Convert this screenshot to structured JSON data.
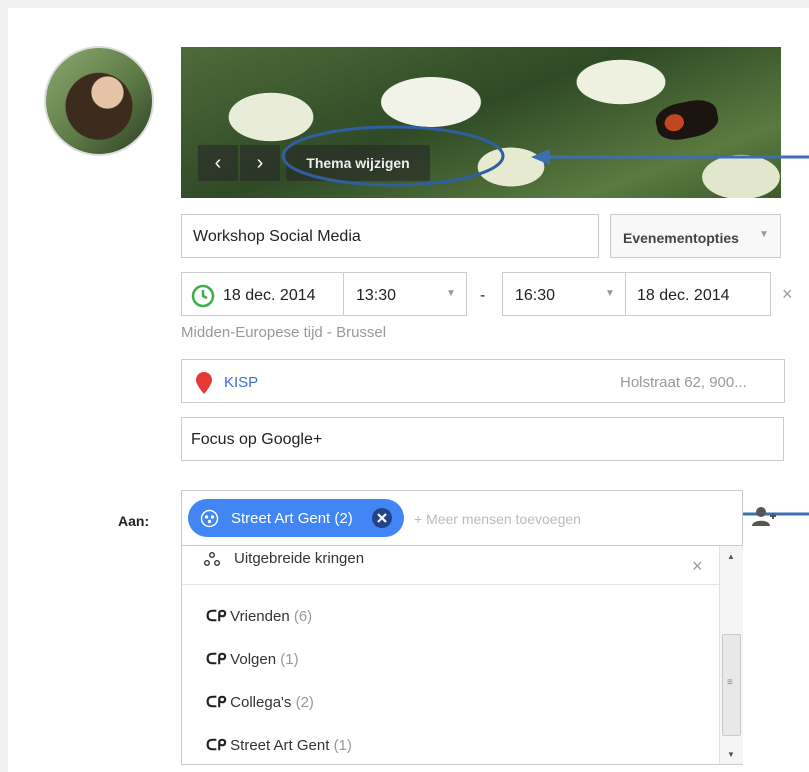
{
  "event": {
    "theme_button": "Thema wijzigen",
    "title_value": "Workshop Social Media",
    "options_label": "Evenementopties",
    "start_date": "18 dec. 2014",
    "start_time": "13:30",
    "separator": "-",
    "end_time": "16:30",
    "end_date": "18 dec. 2014",
    "timezone": "Midden-Europese tijd - Brussel",
    "location_name": "KISP",
    "location_address": "Holstraat 62, 900...",
    "description": "Focus op Google+"
  },
  "recipients": {
    "label": "Aan:",
    "chip_label": "Street Art Gent (2)",
    "add_placeholder": "+ Meer mensen toevoegen"
  },
  "dropdown": {
    "extended": "Uitgebreide kringen",
    "circles": [
      {
        "name": "Vrienden",
        "count": "(6)"
      },
      {
        "name": "Volgen",
        "count": "(1)"
      },
      {
        "name": "Collega's",
        "count": "(2)"
      },
      {
        "name": "Street Art Gent",
        "count": "(1)"
      }
    ]
  },
  "colors": {
    "chip": "#4285f4",
    "annotation": "#2f5f9e",
    "clock": "#3cae4c",
    "pin": "#e53935"
  }
}
